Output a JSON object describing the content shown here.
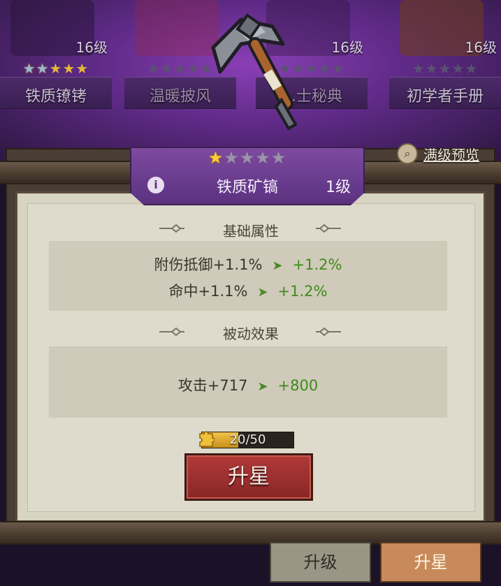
{
  "top_cards": [
    {
      "name": "铁质镣铐",
      "level": "16级",
      "stars_on": 2,
      "stars_total": 5
    },
    {
      "name": "温暖披风",
      "level": "",
      "stars_on": 0,
      "stars_total": 5
    },
    {
      "name": "…士秘典",
      "level": "16级",
      "stars_on": 0,
      "stars_total": 5
    },
    {
      "name": "初学者手册",
      "level": "16级",
      "stars_on": 0,
      "stars_total": 5
    }
  ],
  "preview": {
    "label": "满级预览",
    "icon": "magnifier-icon"
  },
  "item": {
    "name": "铁质矿镐",
    "level": "1级",
    "stars_on": 1,
    "stars_total": 5
  },
  "base_attributes": {
    "header": "基础属性",
    "rows": [
      {
        "label": "附伤抵御+1.1%",
        "next": "+1.2%"
      },
      {
        "label": "命中+1.1%",
        "next": "+1.2%"
      }
    ]
  },
  "passive_effects": {
    "header": "被动效果",
    "rows": [
      {
        "label": "攻击+717",
        "next": "+800"
      }
    ]
  },
  "progress": {
    "text": "20/50",
    "current": 20,
    "max": 50
  },
  "star_up_button": "升星",
  "tabs": {
    "upgrade": "升级",
    "star_up": "升星"
  },
  "colors": {
    "star_on": "#ffcf33",
    "banner": "#6b3d92",
    "positive": "#3f8a1c",
    "button": "#9e3030"
  }
}
